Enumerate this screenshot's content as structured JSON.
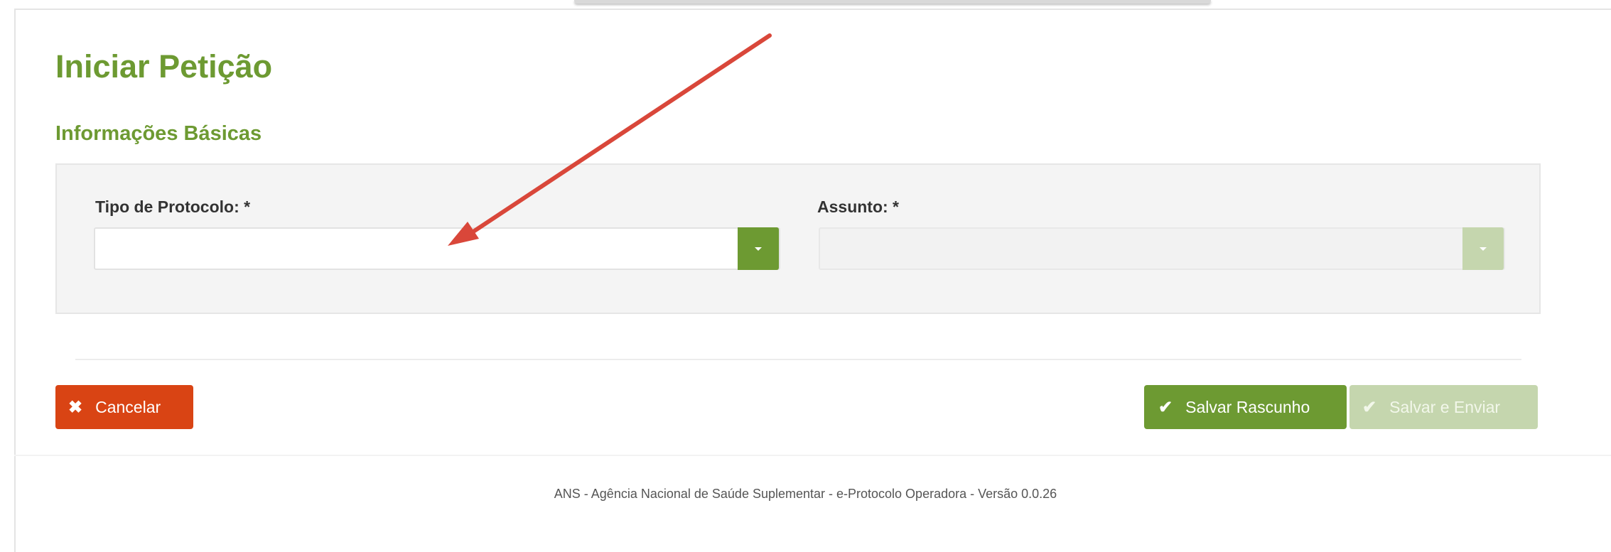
{
  "page": {
    "title": "Iniciar Petição",
    "section_title": "Informações Básicas"
  },
  "form": {
    "tipo_label": "Tipo de Protocolo: *",
    "tipo_value": "",
    "assunto_label": "Assunto: *",
    "assunto_value": ""
  },
  "actions": {
    "cancel_label": "Cancelar",
    "save_draft_label": "Salvar Rascunho",
    "save_send_label": "Salvar e Enviar"
  },
  "footer": {
    "text": "ANS - Agência Nacional de Saúde Suplementar - e-Protocolo Operadora - Versão 0.0.26"
  },
  "colors": {
    "accent": "#6d9a32",
    "accent_disabled": "#c5d6ae",
    "danger": "#d94414",
    "annotation_arrow": "#d9473a"
  },
  "icons": {
    "cancel": "times-icon",
    "save": "check-icon",
    "dropdown": "caret-down-icon"
  }
}
